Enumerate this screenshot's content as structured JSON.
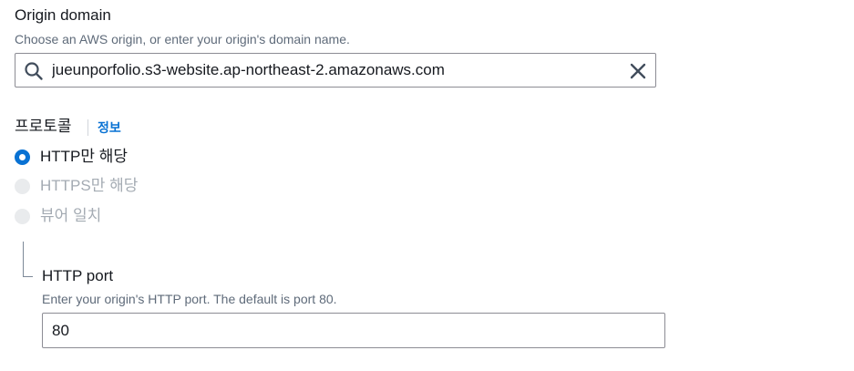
{
  "origin": {
    "label": "Origin domain",
    "description": "Choose an AWS origin, or enter your origin's domain name.",
    "value": "jueunporfolio.s3-website.ap-northeast-2.amazonaws.com",
    "search_icon": "search-icon",
    "clear_icon": "close-icon"
  },
  "protocol": {
    "label": "프로토콜",
    "info_link": "정보",
    "options": [
      {
        "label": "HTTP만 해당",
        "selected": true,
        "disabled": false
      },
      {
        "label": "HTTPS만 해당",
        "selected": false,
        "disabled": true
      },
      {
        "label": "뷰어 일치",
        "selected": false,
        "disabled": true
      }
    ]
  },
  "http_port": {
    "label": "HTTP port",
    "description": "Enter your origin's HTTP port. The default is port 80.",
    "value": "80"
  },
  "colors": {
    "accent": "#0972d3",
    "text": "#16191f",
    "muted": "#5f6b7a",
    "disabled": "#a4abb3"
  }
}
